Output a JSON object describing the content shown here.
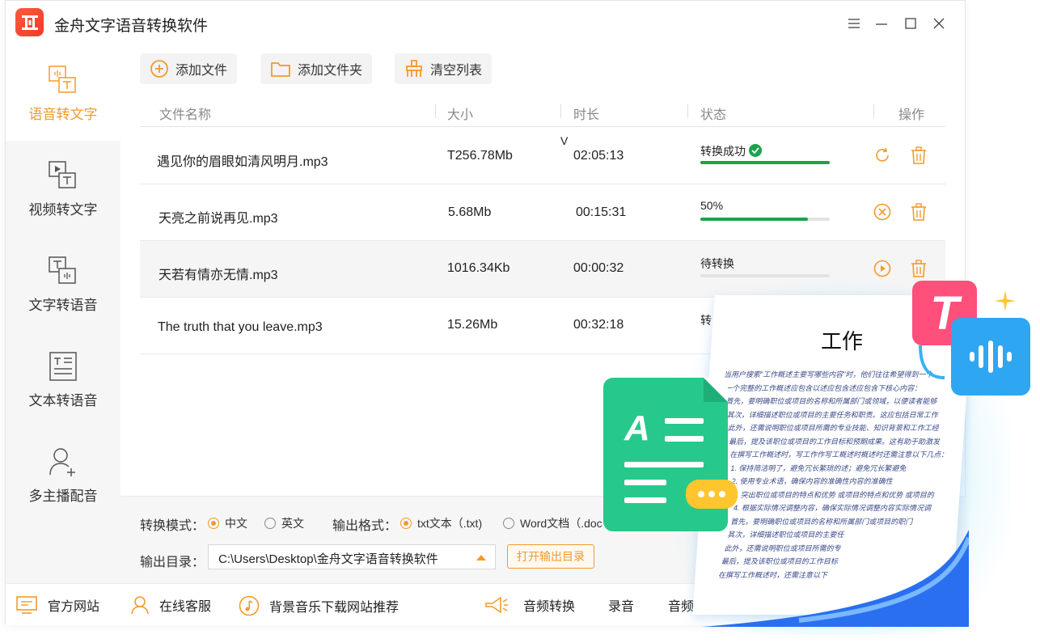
{
  "app": {
    "title": "金舟文字语音转换软件",
    "logo_text": "金"
  },
  "window_controls": [
    "menu-icon",
    "minimize-icon",
    "maximize-icon",
    "close-icon"
  ],
  "colors": {
    "accent": "#f39a2a",
    "success": "#1aa34a",
    "brand_red": "#f23a2a"
  },
  "sidebar": {
    "items": [
      {
        "label": "语音转文字",
        "icon": "speech-to-text-icon",
        "active": true
      },
      {
        "label": "视频转文字",
        "icon": "video-to-text-icon",
        "active": false
      },
      {
        "label": "文字转语音",
        "icon": "text-to-speech-icon",
        "active": false
      },
      {
        "label": "文本转语音",
        "icon": "document-to-speech-icon",
        "active": false
      },
      {
        "label": "多主播配音",
        "icon": "add-user-icon",
        "active": false
      }
    ]
  },
  "toolbar": {
    "add_file": "添加文件",
    "add_folder": "添加文件夹",
    "clear_list": "清空列表"
  },
  "table": {
    "headers": {
      "name": "文件名称",
      "size": "大小",
      "duration": "时长",
      "status": "状态",
      "action": "操作"
    },
    "rows": [
      {
        "name": "遇见你的眉眼如清风明月.mp3",
        "size": "T256.78Mb",
        "duration": "02:05:13",
        "status": "转换成功",
        "progress": 1.0,
        "state": "done"
      },
      {
        "name": "天亮之前说再见.mp3",
        "size": "5.68Mb",
        "duration": "00:15:31",
        "status": "50%",
        "progress": 0.83,
        "state": "converting"
      },
      {
        "name": "天若有情亦无情.mp3",
        "size": "1016.34Kb",
        "duration": "00:00:32",
        "status": "待转换",
        "progress": 0.0,
        "state": "pending"
      },
      {
        "name": "The truth that you leave.mp3",
        "size": "15.26Mb",
        "duration": "00:32:18",
        "status": "转",
        "progress": 0.0,
        "state": "obscured"
      }
    ],
    "stray_mark": "V"
  },
  "settings": {
    "mode_label": "转换模式：",
    "mode_options": [
      "中文",
      "英文"
    ],
    "mode_selected": "中文",
    "format_label": "输出格式：",
    "format_options": [
      "txt文本（.txt)",
      "Word文档（.doc"
    ],
    "format_selected": "txt文本（.txt)",
    "output_label": "输出目录：",
    "output_path": "C:\\Users\\Desktop\\金舟文字语音转换软件",
    "open_output": "打开输出目录"
  },
  "footer": {
    "website": "官方网站",
    "service": "在线客服",
    "music": "背景音乐下载网站推荐",
    "audio_convert": "音频转换",
    "record": "录音",
    "more": "音频"
  },
  "illustration": {
    "doc_title": "工作",
    "doc_lines": [
      "当用户搜索\"工作概述主要写哪些内容\"时，他们往往希望得到一个",
      "一个完整的工作概述应包含以述应包含述应包含下核心内容：",
      "首先，要明确职位或项目的名称和所属部门或领域，以便读者能够",
      "其次，详细描述职位或项目的主要任务和职责。这应包括日常工作",
      "此外，还需说明职位或项目所需的专业技能、知识背景和工作工经",
      "最后，提及该职位或项目的工作目标和预期成果。这有助于助激发",
      "在撰写工作概述时，写工作作写工概述时概述时还需注意以下几点：",
      "1. 保持简洁明了，避免冗长繁琐的述；避免冗长繁避免",
      "2. 使用专业术语，确保内容的准确性内容的准确性",
      "3. 突出职位或项目的特点和优势 或项目的特点和优势 或项目的",
      "4. 根据实际情况调整内容，确保实际情况调整内容实际情况调",
      "首先，要明确职位或项目的名称和所属部门或项目的职门",
      "其次，详细描述职位或项目的主要任",
      "此外，还需说明职位或项目所需的专",
      "最后，提及该职位或项目的工作目标",
      "在撰写工作概述时，还需注意以下"
    ],
    "green_letter": "A",
    "pink_letter": "T"
  }
}
